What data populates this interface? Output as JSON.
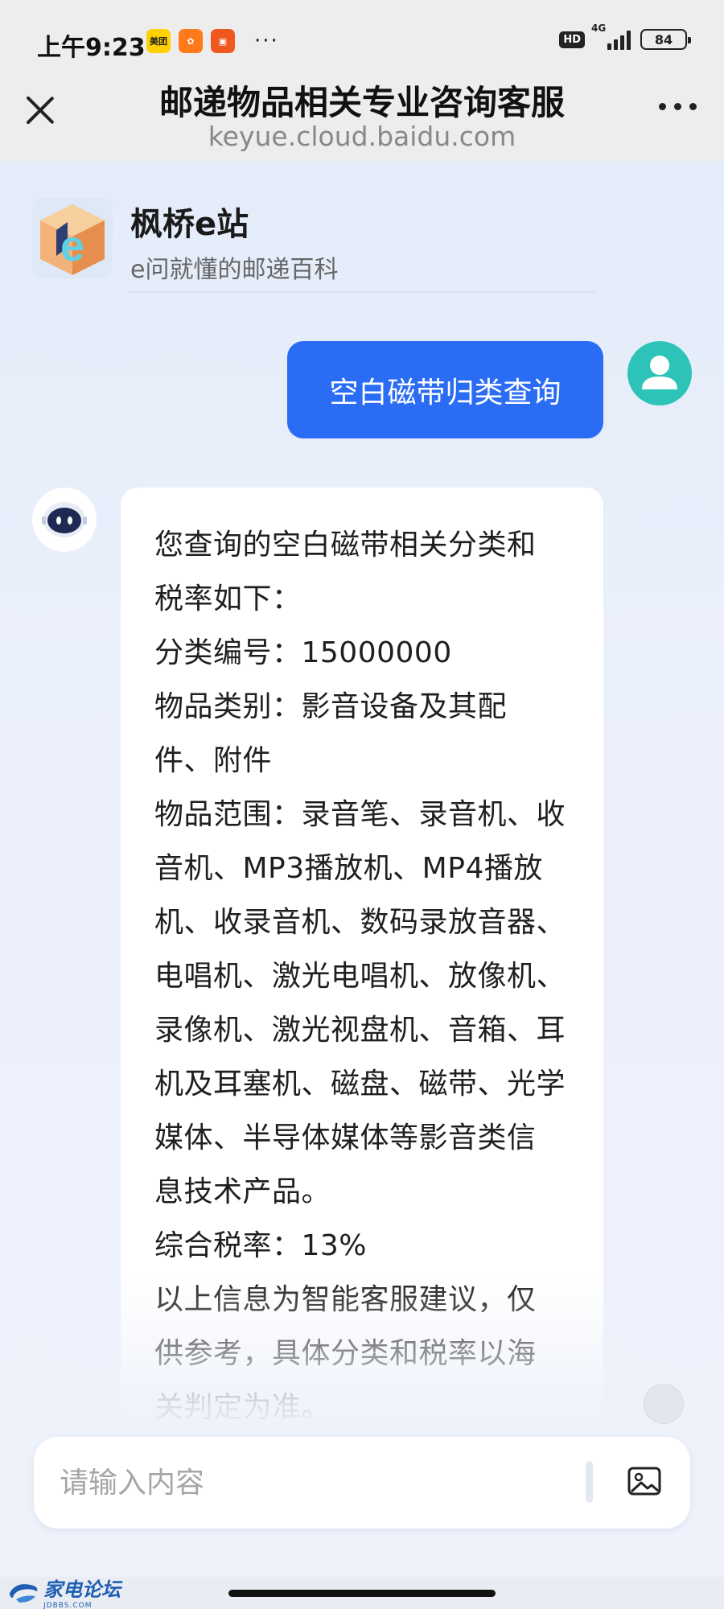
{
  "status_bar": {
    "time": "上午9:23",
    "app_icons": [
      {
        "name": "meituan-icon",
        "label": "美团",
        "color": "#ffd100"
      },
      {
        "name": "app-orange-icon",
        "label": "",
        "color": "#ff7a1a"
      },
      {
        "name": "app-red-icon",
        "label": "",
        "color": "#f0591e"
      }
    ],
    "more": "···",
    "hd": "HD",
    "network": "4G",
    "battery": "84"
  },
  "title_bar": {
    "title": "邮递物品相关专业咨询客服",
    "subtitle": "keyue.cloud.baidu.com"
  },
  "bot_header": {
    "name": "枫桥e站",
    "description": "e问就懂的邮递百科"
  },
  "messages": {
    "user_query": "空白磁带归类查询",
    "bot_reply": "您查询的空白磁带相关分类和\n税率如下：\n分类编号：15000000\n物品类别：影音设备及其配\n件、附件\n物品范围：录音笔、录音机、收\n音机、MP3播放机、MP4播放\n机、收录音机、数码录放音器、\n电唱机、激光电唱机、放像机、\n录像机、激光视盘机、音箱、耳\n机及耳塞机、磁盘、磁带、光学\n媒体、半导体媒体等影音类信\n息技术产品。\n综合税率：13%\n以上信息为智能客服建议，仅\n供参考，具体分类和税率以海\n关判定为准。"
  },
  "input": {
    "placeholder": "请输入内容",
    "value": ""
  },
  "watermark": {
    "text": "家电论坛",
    "sub": "JDBBS.COM"
  },
  "colors": {
    "accent": "#2a6df4",
    "user_avatar": "#2ec3b8"
  }
}
